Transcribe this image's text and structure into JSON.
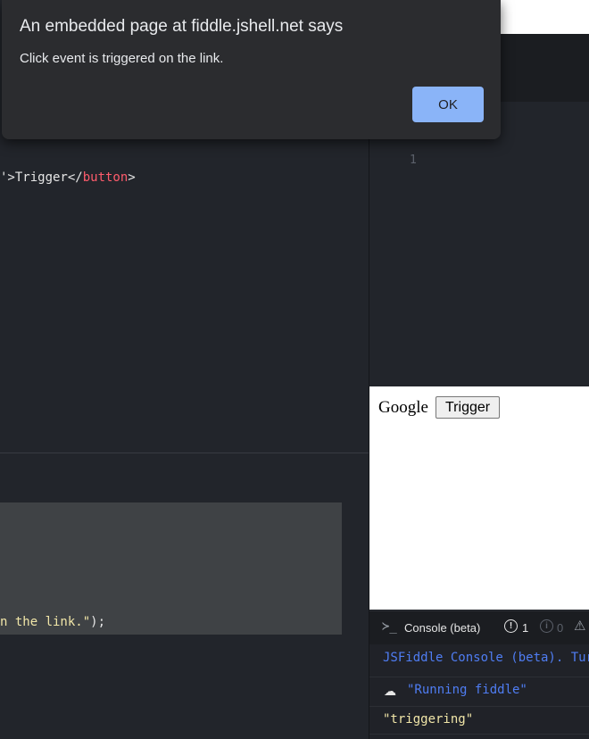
{
  "alert": {
    "title": "An embedded page at fiddle.jshell.net says",
    "message": "Click event is triggered on the link.",
    "ok_label": "OK"
  },
  "html_editor": {
    "line_prefix": "'>Trigger</",
    "tag_name": "button",
    "line_suffix": ">"
  },
  "css_editor": {
    "line_number": "1"
  },
  "js_editor": {
    "line_text": "n the link.\"",
    "line_end": ");"
  },
  "result": {
    "link_text": "Google",
    "button_label": "Trigger"
  },
  "console": {
    "prompt_symbol": "≻_",
    "title": "Console (beta)",
    "warning_count": "1",
    "info_count": "0",
    "lines": [
      "JSFiddle Console (beta). Tur",
      "\"Running fiddle\"",
      "\"triggering\""
    ]
  },
  "colors": {
    "background": "#202228",
    "accent": "#8ab4f8",
    "tag": "#ff5c6c",
    "string": "#f1e6a8",
    "console_info": "#4f7df3"
  }
}
